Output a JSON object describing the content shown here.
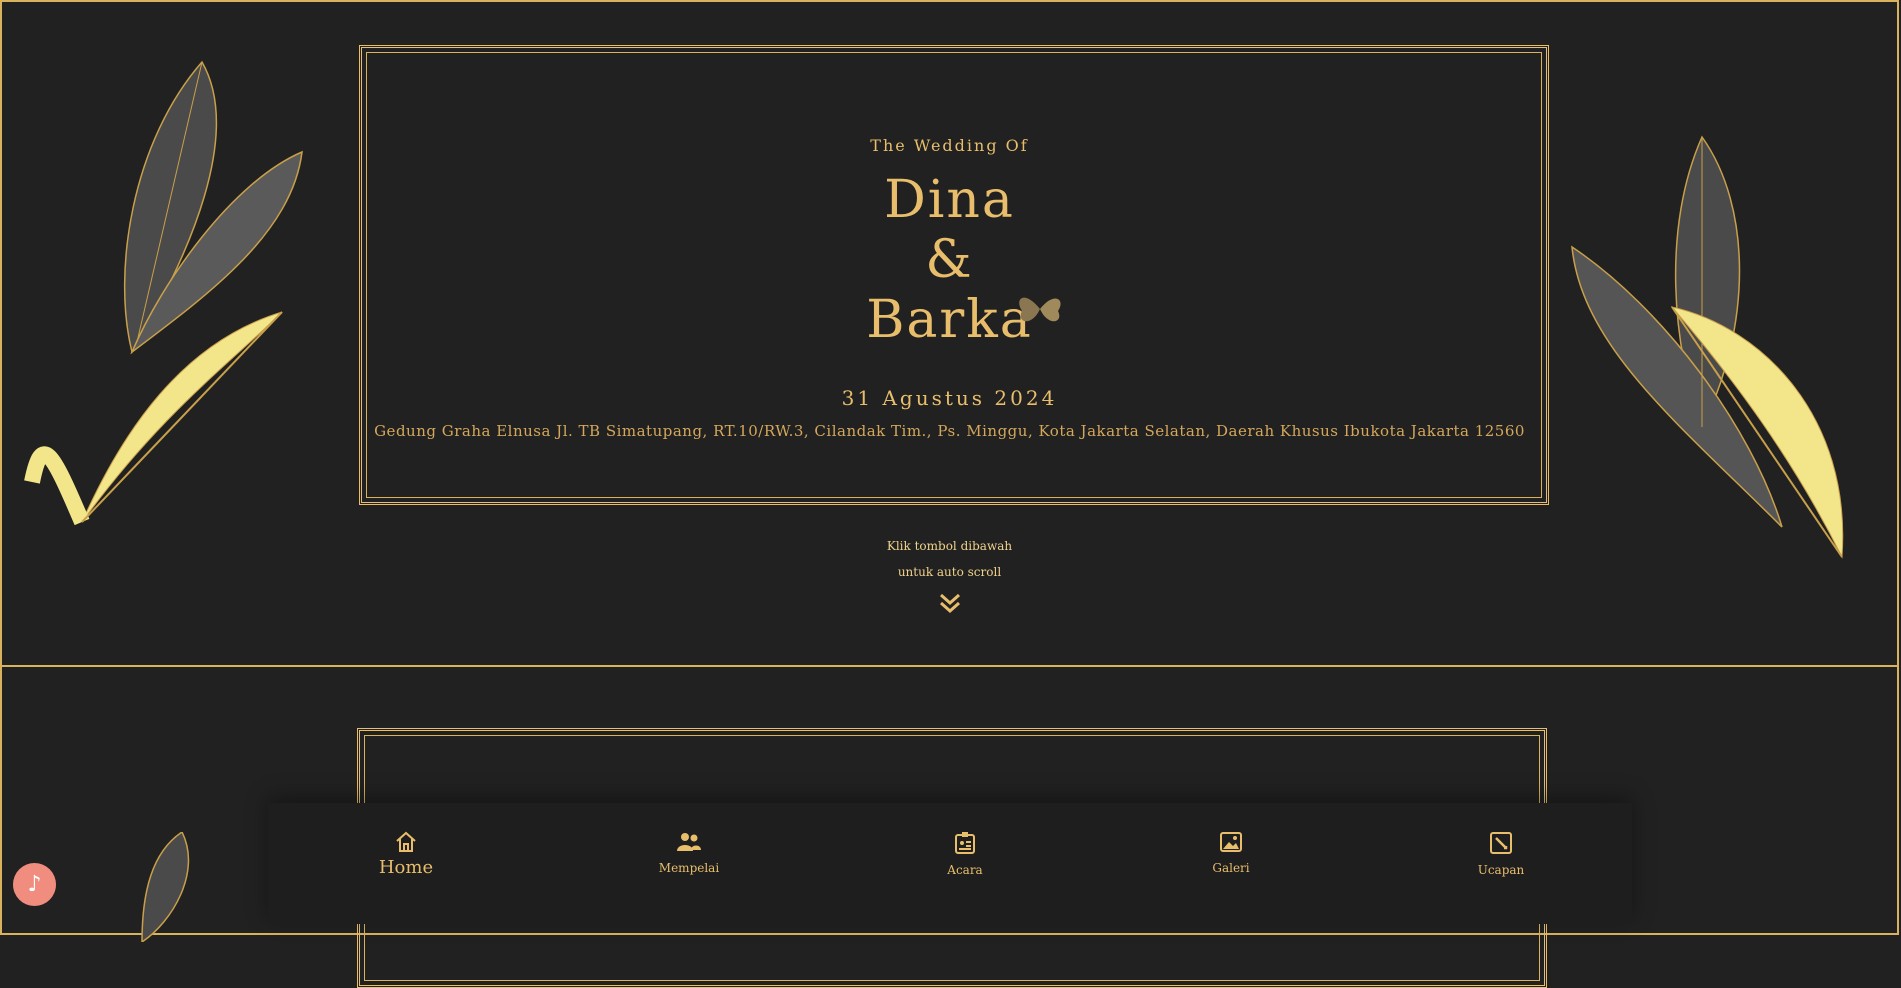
{
  "cover": {
    "subtitle": "The Wedding Of",
    "name1": "Dina",
    "amp": "&",
    "name2": "Barka",
    "date": "31 Agustus 2024",
    "address": "Gedung Graha Elnusa Jl. TB Simatupang, RT.10/RW.3, Cilandak Tim., Ps. Minggu, Kota Jakarta Selatan, Daerah Khusus Ibukota Jakarta 12560",
    "hint_line1": "Klik tombol dibawah",
    "hint_line2": "untuk auto scroll"
  },
  "nav": {
    "items": [
      {
        "label": "Home",
        "icon": "home-icon",
        "active": true
      },
      {
        "label": "Mempelai",
        "icon": "couple-icon"
      },
      {
        "label": "Acara",
        "icon": "event-icon"
      },
      {
        "label": "Galeri",
        "icon": "gallery-icon"
      },
      {
        "label": "Ucapan",
        "icon": "message-icon"
      }
    ]
  },
  "music": {
    "icon": "music-note-icon",
    "glyph": "♪"
  },
  "colors": {
    "background": "#212121",
    "gold": "#e8be6c",
    "music_button": "#f08d7e"
  }
}
